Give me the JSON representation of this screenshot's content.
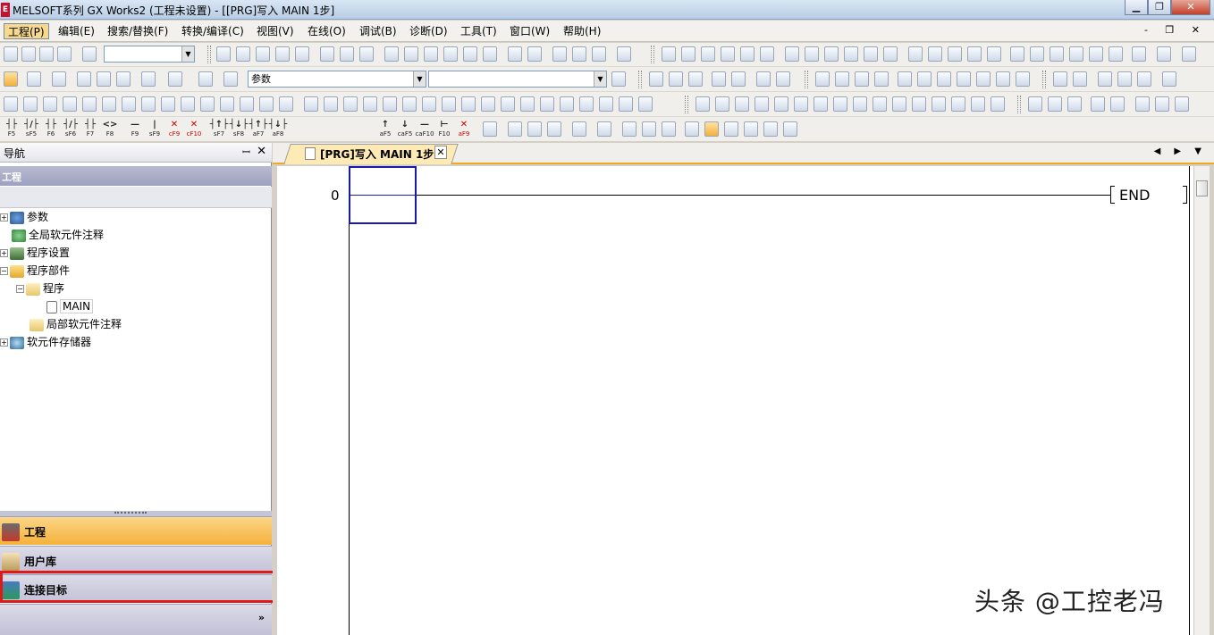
{
  "window": {
    "title": "MELSOFT系列 GX Works2 (工程未设置) - [[PRG]写入 MAIN 1步]",
    "app_icon_text": "E",
    "buttons": {
      "minimize": "▁",
      "restore": "❐",
      "close": "✕"
    }
  },
  "menu": {
    "items": [
      {
        "label": "工程(P)"
      },
      {
        "label": "编辑(E)"
      },
      {
        "label": "搜索/替换(F)"
      },
      {
        "label": "转换/编译(C)"
      },
      {
        "label": "视图(V)"
      },
      {
        "label": "在线(O)"
      },
      {
        "label": "调试(B)"
      },
      {
        "label": "诊断(D)"
      },
      {
        "label": "工具(T)"
      },
      {
        "label": "窗口(W)"
      },
      {
        "label": "帮助(H)"
      }
    ],
    "mdi_controls": "- ❐ ✕"
  },
  "toolbar": {
    "combo_param": "参数",
    "ladder_keys": [
      {
        "sym": "┤├",
        "key": "F5"
      },
      {
        "sym": "┤/├",
        "key": "sF5"
      },
      {
        "sym": "┤├",
        "key": "F6"
      },
      {
        "sym": "┤/├",
        "key": "sF6"
      },
      {
        "sym": "┤├",
        "key": "F7"
      },
      {
        "sym": "<>",
        "key": "F8"
      },
      {
        "sym": "—",
        "key": "F9"
      },
      {
        "sym": "|",
        "key": "sF9"
      },
      {
        "sym": "✕",
        "key": "cF9"
      },
      {
        "sym": "✕",
        "key": "cF10"
      },
      {
        "sym": "┤↑├",
        "key": "sF7"
      },
      {
        "sym": "┤↓├",
        "key": "sF8"
      },
      {
        "sym": "┤↑├",
        "key": "aF7"
      },
      {
        "sym": "┤↓├",
        "key": "aF8"
      },
      {
        "sym": "↑",
        "key": "aF5"
      },
      {
        "sym": "↓",
        "key": "caF5"
      },
      {
        "sym": "—",
        "key": "caF10"
      },
      {
        "sym": "⊢",
        "key": "F10"
      },
      {
        "sym": "✕",
        "key": "aF9"
      }
    ]
  },
  "nav": {
    "title": "导航",
    "pin": "ꟷ",
    "close": "✕",
    "section": "工程",
    "tree": [
      {
        "label": "参数",
        "expander": "+"
      },
      {
        "label": "全局软元件注释",
        "expander": ""
      },
      {
        "label": "程序设置",
        "expander": "+"
      },
      {
        "label": "程序部件",
        "expander": "−"
      },
      {
        "label": "程序",
        "expander": "−"
      },
      {
        "label": "MAIN",
        "expander": ""
      },
      {
        "label": "局部软元件注释",
        "expander": ""
      },
      {
        "label": "软元件存储器",
        "expander": "+"
      }
    ],
    "panels": {
      "project": "工程",
      "library": "用户库",
      "target": "连接目标",
      "more": "»"
    }
  },
  "editor": {
    "tab_title": "[PRG]写入 MAIN 1步",
    "tab_close": "✕",
    "tab_nav": "◀ ▶ ▼",
    "step_number": "0",
    "end_instruction": "END"
  },
  "watermark": "头条 @工控老冯",
  "colors": {
    "active_tab": "#fdeab4",
    "active_panel": "#f4b13a",
    "highlight_box": "#e01818",
    "cursor": "#1a1aa8"
  }
}
